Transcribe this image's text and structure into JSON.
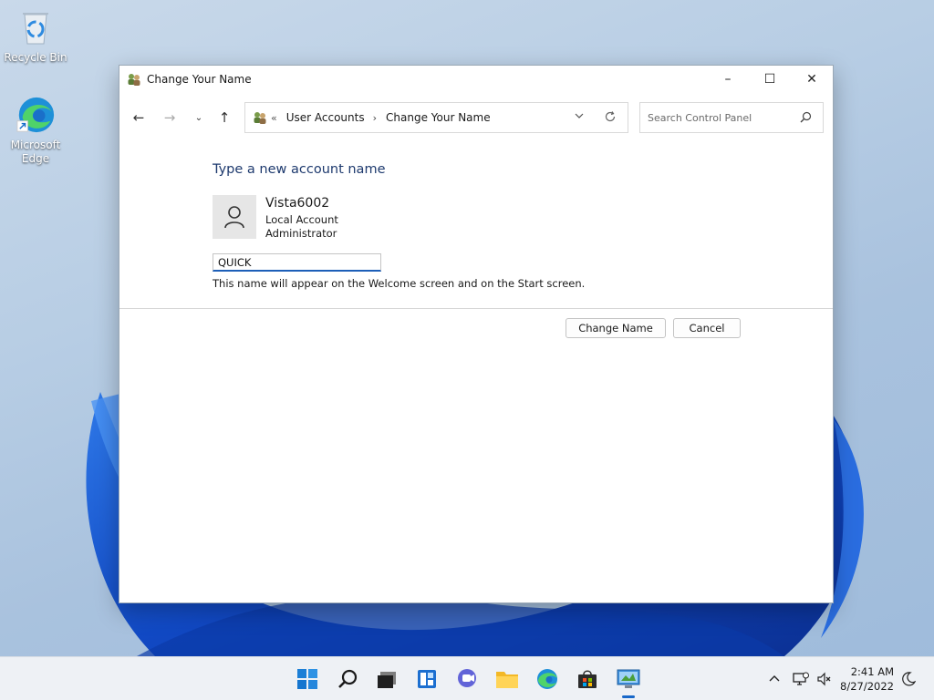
{
  "desktop": {
    "icons": [
      {
        "label": "Recycle Bin",
        "icon": "recycle-bin-icon"
      },
      {
        "label": "Microsoft Edge",
        "icon": "edge-icon"
      }
    ]
  },
  "window": {
    "title": "Change Your Name",
    "controls": {
      "minimize": "–",
      "maximize": "☐",
      "close": "✕"
    }
  },
  "navigation": {
    "back": "←",
    "forward": "→",
    "recent": "⌄",
    "up": "↑",
    "breadcrumb_overflow": "«",
    "breadcrumbs": [
      "User Accounts",
      "Change Your Name"
    ],
    "breadcrumb_separator": "›",
    "search_placeholder": "Search Control Panel"
  },
  "form": {
    "heading": "Type a new account name",
    "account": {
      "name": "Vista6002",
      "type": "Local Account",
      "role": "Administrator"
    },
    "name_value": "QUICK",
    "hint": "This name will appear on the Welcome screen and on the Start screen.",
    "change_button": "Change Name",
    "cancel_button": "Cancel"
  },
  "taskbar": {
    "apps": [
      "start-icon",
      "search-icon",
      "task-view-icon",
      "widgets-icon",
      "teams-chat-icon",
      "file-explorer-icon",
      "edge-icon",
      "store-icon",
      "control-panel-icon"
    ],
    "accent_color": "#1868c9"
  },
  "clock": {
    "time": "2:41 AM",
    "date": "8/27/2022"
  }
}
